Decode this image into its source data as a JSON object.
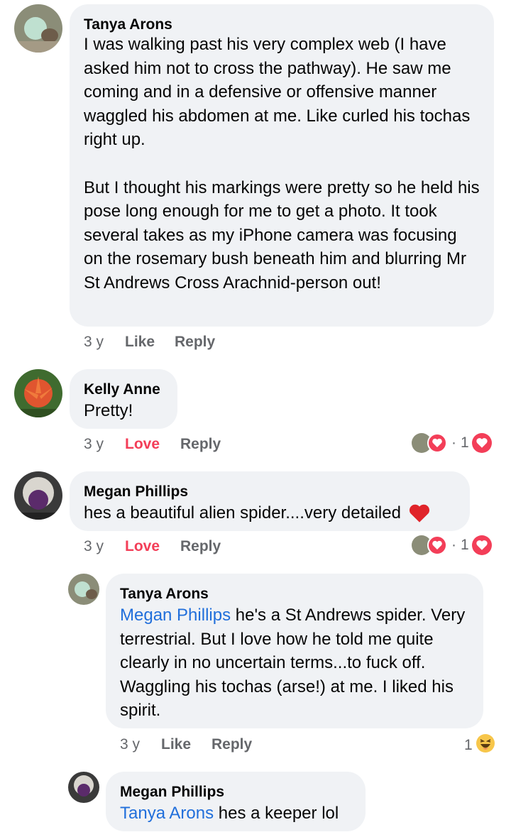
{
  "comments": [
    {
      "author": "Tanya Arons",
      "text": "I was walking past his very complex web (I have asked him not to cross the pathway). He saw me coming and in a defensive or offensive manner waggled his abdomen at me.  Like curled his tochas right up.\n\nBut I thought his markings were pretty so he held his pose long enough for me to get a photo. It took several takes as my iPhone camera was focusing on the rosemary bush  beneath him and blurring Mr St Andrews  Cross Arachnid-person out!",
      "time": "3 y",
      "like": "Like",
      "reply": "Reply"
    },
    {
      "author": "Kelly Anne",
      "text": "Pretty!",
      "time": "3 y",
      "like": "Love",
      "reply": "Reply",
      "reaction_prefix": "·",
      "reaction_count": "1"
    },
    {
      "author": "Megan Phillips",
      "text": "hes a beautiful alien spider....very detailed",
      "time": "3 y",
      "like": "Love",
      "reply": "Reply",
      "reaction_prefix": "·",
      "reaction_count": "1"
    },
    {
      "author": "Tanya Arons",
      "mention": "Megan Phillips",
      "text": " he's a St  Andrews spider. Very terrestrial.  But I love how he told me quite clearly in no uncertain terms...to fuck off.  Waggling his tochas (arse!) at me.  I liked his spirit.",
      "time": "3 y",
      "like": "Like",
      "reply": "Reply",
      "reaction_count": "1"
    },
    {
      "author": "Megan Phillips",
      "mention": "Tanya Arons",
      "text": " hes a keeper lol"
    }
  ],
  "icons": {
    "heart": "red-heart-icon",
    "love_reaction": "love-reaction-icon",
    "haha": "haha-reaction-icon"
  },
  "colors": {
    "love": "#f33e58",
    "mention": "#216fdb",
    "bubble": "#f0f2f5",
    "meta": "#65676b"
  }
}
